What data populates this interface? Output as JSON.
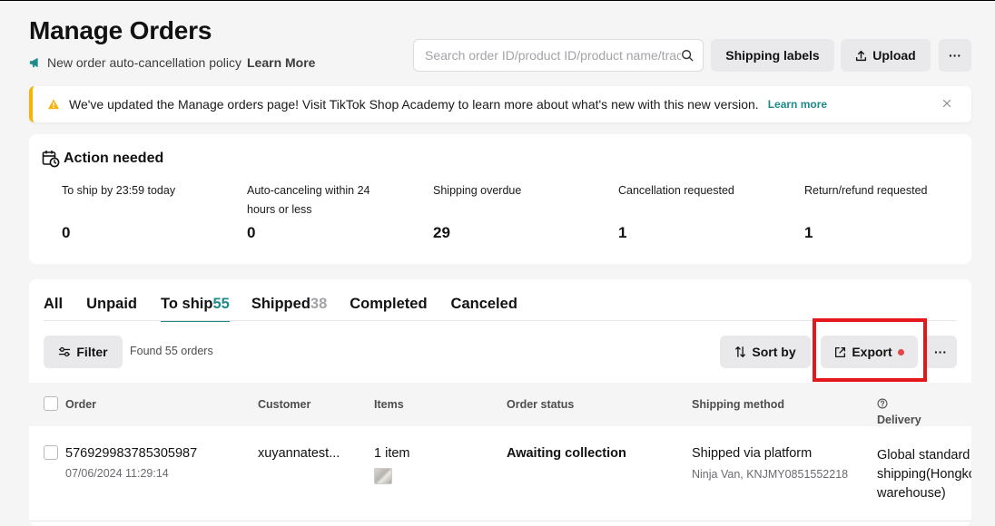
{
  "header": {
    "title": "Manage Orders",
    "policy_text": "New order auto-cancellation policy",
    "policy_link": "Learn More",
    "search_placeholder": "Search order ID/product ID/product name/tracking ID",
    "shipping_labels": "Shipping labels",
    "upload": "Upload",
    "more": "···"
  },
  "banner": {
    "message": "We've updated the Manage orders page! Visit TikTok Shop Academy to learn more about what's new with this new version.",
    "link": "Learn more"
  },
  "action_needed": {
    "title": "Action needed",
    "metrics": [
      {
        "label": "To ship by 23:59 today",
        "value": "0"
      },
      {
        "label": "Auto-canceling within 24 hours or less",
        "value": "0"
      },
      {
        "label": "Shipping overdue",
        "value": "29"
      },
      {
        "label": "Cancellation requested",
        "value": "1"
      },
      {
        "label": "Return/refund requested",
        "value": "1"
      }
    ]
  },
  "tabs": [
    {
      "label": "All",
      "count": ""
    },
    {
      "label": "Unpaid",
      "count": ""
    },
    {
      "label": "To ship",
      "count": "55"
    },
    {
      "label": "Shipped",
      "count": "38"
    },
    {
      "label": "Completed",
      "count": ""
    },
    {
      "label": "Canceled",
      "count": ""
    }
  ],
  "toolbar": {
    "filter": "Filter",
    "found": "Found 55 orders",
    "sort_by": "Sort by",
    "export": "Export",
    "more": "···"
  },
  "table": {
    "columns": [
      "Order",
      "Customer",
      "Items",
      "Order status",
      "Shipping method",
      "Delivery option"
    ],
    "rows": [
      {
        "order_id": "576929983785305987",
        "date": "07/06/2024 11:29:14",
        "customer": "xuyannatest...",
        "items": "1 item",
        "status": "Awaiting collection",
        "shipping_method": "Shipped via platform",
        "shipping_detail": "Ninja Van, KNJMY0851552218",
        "delivery_option": "Global standard shipping(Hongkong warehouse)"
      }
    ]
  },
  "colors": {
    "accent": "#1e8a8a",
    "warning": "#f6b30a",
    "highlight": "#e3171c"
  }
}
